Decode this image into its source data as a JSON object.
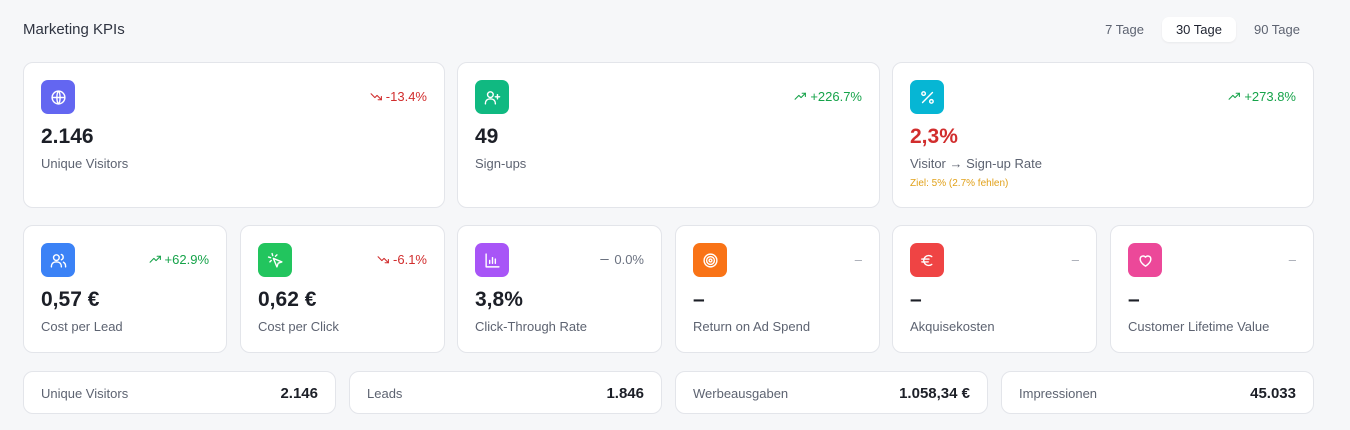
{
  "header": {
    "title": "Marketing KPIs",
    "ranges": [
      "7 Tage",
      "30 Tage",
      "90 Tage"
    ],
    "active_range": "30 Tage"
  },
  "top_cards": [
    {
      "icon": "globe-icon",
      "icon_color": "#6366f1",
      "trend": "-13.4%",
      "trend_dir": "down",
      "value": "2.146",
      "label": "Unique Visitors"
    },
    {
      "icon": "user-plus-icon",
      "icon_color": "#10b981",
      "trend": "+226.7%",
      "trend_dir": "up",
      "value": "49",
      "label": "Sign-ups"
    },
    {
      "icon": "percent-icon",
      "icon_color": "#06b6d4",
      "trend": "+273.8%",
      "trend_dir": "up",
      "value": "2,3%",
      "label": "Visitor → Sign-up Rate",
      "goal": "Ziel: 5% (2.7% fehlen)"
    }
  ],
  "mid_cards": [
    {
      "icon": "users-icon",
      "icon_color": "#3b82f6",
      "trend": "+62.9%",
      "trend_dir": "up",
      "value": "0,57 €",
      "label": "Cost per Lead"
    },
    {
      "icon": "cursor-click-icon",
      "icon_color": "#22c55e",
      "trend": "-6.1%",
      "trend_dir": "down",
      "value": "0,62 €",
      "label": "Cost per Click"
    },
    {
      "icon": "bar-chart-icon",
      "icon_color": "#a855f7",
      "trend": "0.0%",
      "trend_dir": "flat",
      "value": "3,8%",
      "label": "Click-Through Rate"
    },
    {
      "icon": "target-icon",
      "icon_color": "#f97316",
      "trend": "–",
      "trend_dir": "none",
      "value": "–",
      "label": "Return on Ad Spend"
    },
    {
      "icon": "euro-icon",
      "icon_color": "#ef4444",
      "trend": "–",
      "trend_dir": "none",
      "value": "–",
      "label": "Akquisekosten"
    },
    {
      "icon": "heart-icon",
      "icon_color": "#ec4899",
      "trend": "–",
      "trend_dir": "none",
      "value": "–",
      "label": "Customer Lifetime Value"
    }
  ],
  "summary": [
    {
      "label": "Unique Visitors",
      "value": "2.146"
    },
    {
      "label": "Leads",
      "value": "1.846"
    },
    {
      "label": "Werbeausgaben",
      "value": "1.058,34 €"
    },
    {
      "label": "Impressionen",
      "value": "45.033"
    }
  ]
}
